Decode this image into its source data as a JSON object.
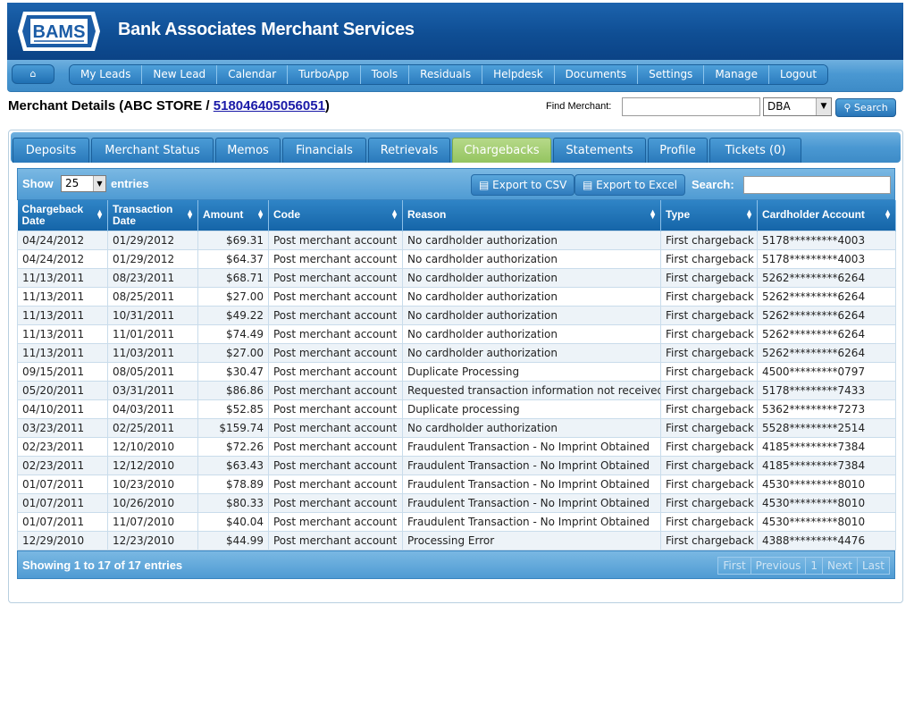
{
  "brand": {
    "logo_text": "BAMS",
    "title": "Bank Associates Merchant Services"
  },
  "nav": {
    "home_icon": "home-icon",
    "items": [
      "My Leads",
      "New Lead",
      "Calendar",
      "TurboApp",
      "Tools",
      "Residuals",
      "Helpdesk",
      "Documents",
      "Settings",
      "Manage",
      "Logout"
    ]
  },
  "merchant": {
    "prefix": "Merchant Details (ABC STORE / ",
    "id": "518046405056051",
    "suffix": ")"
  },
  "find": {
    "label": "Find Merchant:",
    "value": "",
    "select_value": "DBA",
    "search_label": "Search"
  },
  "tabs": [
    {
      "label": "Deposits",
      "active": false
    },
    {
      "label": "Merchant Status",
      "active": false
    },
    {
      "label": "Memos",
      "active": false
    },
    {
      "label": "Financials",
      "active": false
    },
    {
      "label": "Retrievals",
      "active": false
    },
    {
      "label": "Chargebacks",
      "active": true
    },
    {
      "label": "Statements",
      "active": false
    },
    {
      "label": "Profile",
      "active": false
    },
    {
      "label": "Tickets (0)",
      "active": false
    }
  ],
  "table_toolbar": {
    "show_label": "Show",
    "page_size": "25",
    "entries_label": "entries",
    "export_csv": "Export to CSV",
    "export_excel": "Export to Excel",
    "search_label": "Search:",
    "search_value": ""
  },
  "columns": [
    "Chargeback Date",
    "Transaction Date",
    "Amount",
    "Code",
    "Reason",
    "Type",
    "Cardholder Account"
  ],
  "rows": [
    [
      "04/24/2012",
      "01/29/2012",
      "$69.31",
      "Post merchant account",
      "No cardholder authorization",
      "First chargeback",
      "5178*********4003"
    ],
    [
      "04/24/2012",
      "01/29/2012",
      "$64.37",
      "Post merchant account",
      "No cardholder authorization",
      "First chargeback",
      "5178*********4003"
    ],
    [
      "11/13/2011",
      "08/23/2011",
      "$68.71",
      "Post merchant account",
      "No cardholder authorization",
      "First chargeback",
      "5262*********6264"
    ],
    [
      "11/13/2011",
      "08/25/2011",
      "$27.00",
      "Post merchant account",
      "No cardholder authorization",
      "First chargeback",
      "5262*********6264"
    ],
    [
      "11/13/2011",
      "10/31/2011",
      "$49.22",
      "Post merchant account",
      "No cardholder authorization",
      "First chargeback",
      "5262*********6264"
    ],
    [
      "11/13/2011",
      "11/01/2011",
      "$74.49",
      "Post merchant account",
      "No cardholder authorization",
      "First chargeback",
      "5262*********6264"
    ],
    [
      "11/13/2011",
      "11/03/2011",
      "$27.00",
      "Post merchant account",
      "No cardholder authorization",
      "First chargeback",
      "5262*********6264"
    ],
    [
      "09/15/2011",
      "08/05/2011",
      "$30.47",
      "Post merchant account",
      "Duplicate Processing",
      "First chargeback",
      "4500*********0797"
    ],
    [
      "05/20/2011",
      "03/31/2011",
      "$86.86",
      "Post merchant account",
      "Requested transaction information not received",
      "First chargeback",
      "5178*********7433"
    ],
    [
      "04/10/2011",
      "04/03/2011",
      "$52.85",
      "Post merchant account",
      "Duplicate processing",
      "First chargeback",
      "5362*********7273"
    ],
    [
      "03/23/2011",
      "02/25/2011",
      "$159.74",
      "Post merchant account",
      "No cardholder authorization",
      "First chargeback",
      "5528*********2514"
    ],
    [
      "02/23/2011",
      "12/10/2010",
      "$72.26",
      "Post merchant account",
      "Fraudulent Transaction - No Imprint Obtained",
      "First chargeback",
      "4185*********7384"
    ],
    [
      "02/23/2011",
      "12/12/2010",
      "$63.43",
      "Post merchant account",
      "Fraudulent Transaction - No Imprint Obtained",
      "First chargeback",
      "4185*********7384"
    ],
    [
      "01/07/2011",
      "10/23/2010",
      "$78.89",
      "Post merchant account",
      "Fraudulent Transaction - No Imprint Obtained",
      "First chargeback",
      "4530*********8010"
    ],
    [
      "01/07/2011",
      "10/26/2010",
      "$80.33",
      "Post merchant account",
      "Fraudulent Transaction - No Imprint Obtained",
      "First chargeback",
      "4530*********8010"
    ],
    [
      "01/07/2011",
      "11/07/2010",
      "$40.04",
      "Post merchant account",
      "Fraudulent Transaction - No Imprint Obtained",
      "First chargeback",
      "4530*********8010"
    ],
    [
      "12/29/2010",
      "12/23/2010",
      "$44.99",
      "Post merchant account",
      "Processing Error",
      "First chargeback",
      "4388*********4476"
    ]
  ],
  "footer": {
    "showing": "Showing 1 to 17 of 17 entries",
    "pager": [
      "First",
      "Previous",
      "1",
      "Next",
      "Last"
    ]
  },
  "colors": {
    "header_blue": "#0f4e94",
    "nav_blue": "#4a98d2",
    "active_tab": "#94c460",
    "link": "#1a1aa8"
  }
}
